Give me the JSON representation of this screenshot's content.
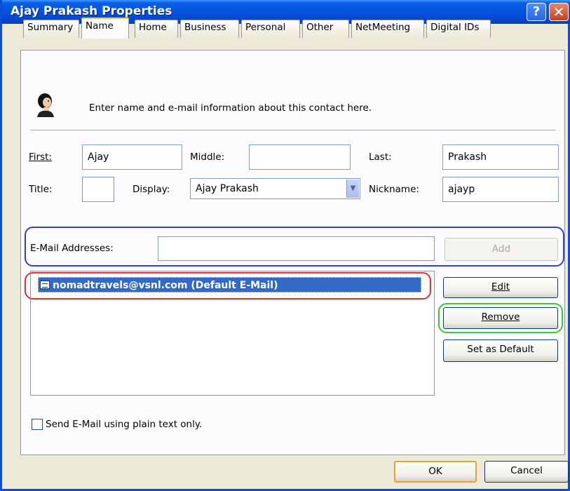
{
  "window": {
    "title": "Ajay Prakash Properties",
    "help_glyph": "?",
    "close_glyph": "✕"
  },
  "tabs": [
    {
      "label": "Summary"
    },
    {
      "label": "Name"
    },
    {
      "label": "Home"
    },
    {
      "label": "Business"
    },
    {
      "label": "Personal"
    },
    {
      "label": "Other"
    },
    {
      "label": "NetMeeting"
    },
    {
      "label": "Digital IDs"
    }
  ],
  "selected_tab": "Name",
  "header": {
    "instruction": "Enter name and e-mail information about this contact here."
  },
  "name_fields": {
    "first_label": "First:",
    "first_value": "Ajay",
    "middle_label": "Middle:",
    "middle_value": "",
    "last_label": "Last:",
    "last_value": "Prakash",
    "title_label": "Title:",
    "title_value": "",
    "display_label": "Display:",
    "display_value": "Ajay Prakash",
    "nickname_label": "Nickname:",
    "nickname_value": "ajayp"
  },
  "email": {
    "label": "E-Mail Addresses:",
    "input_value": "",
    "add_label": "Add",
    "list": [
      "nomadtravels@vsnl.com  (Default E-Mail)"
    ],
    "edit_label": "Edit",
    "remove_label": "Remove",
    "set_default_label": "Set as Default"
  },
  "plain_text": {
    "label": "Send E-Mail using plain text only.",
    "checked": false
  },
  "footer": {
    "ok_label": "OK",
    "cancel_label": "Cancel"
  },
  "colors": {
    "titlebar": "#0553e0",
    "selection": "#316ac5",
    "highlight_blue": "#2d3fd8",
    "highlight_red": "#e0312a",
    "highlight_green": "#33cc33"
  }
}
